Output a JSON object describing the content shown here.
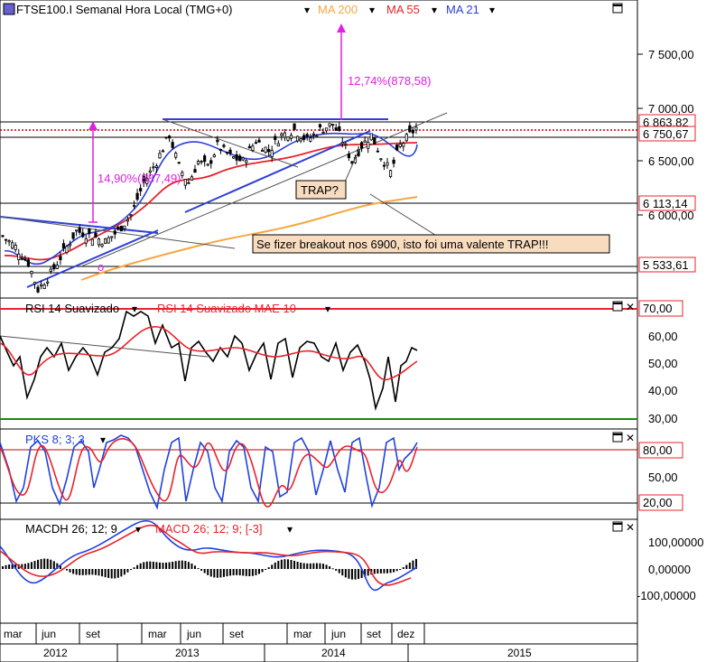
{
  "colors": {
    "ma200": "#f5a742",
    "ma55": "#e8232b",
    "ma21": "#2e3fd6",
    "magenta": "#e020e0",
    "rsi": "#000000",
    "rsi_ma": "#e8232b",
    "pks_k": "#2040e0",
    "pks_d": "#e8232b",
    "note_bg": "#f8dcc0",
    "green": "#1a8a1a"
  },
  "header": {
    "symbol": "FTSE100.I Semanal Hora Local (TMG+0)",
    "ma200": "MA 200",
    "ma55": "MA 55",
    "ma21": "MA 21"
  },
  "annotations": {
    "up_move": "12,74%(878,58)",
    "prior_move": "14,90%(887,49)",
    "trap": "TRAP?",
    "note": "Se fizer breakout nos 6900, isto foi uma valente TRAP!!!",
    "circle_marker": "o"
  },
  "price_panel": {
    "ticks": [
      "7 500,00",
      "7 000,00",
      "6 500,00",
      "6 000,00"
    ],
    "tags": [
      "6 863,82",
      "6 750,67",
      "6 113,14",
      "5 533,61"
    ]
  },
  "rsi_panel": {
    "title": "RSI 14 Suavizado",
    "title2": "RSI 14 Suavizado MAE 10",
    "ticks": [
      "60,00",
      "50,00",
      "40,00",
      "30,00"
    ],
    "tag": "70,00"
  },
  "pks_panel": {
    "title": "PKS 8; 3; 3",
    "ticks": [
      "50,00"
    ],
    "tags": [
      "80,00",
      "20,00"
    ]
  },
  "macd_panel": {
    "title": "MACDH 26; 12; 9",
    "title2": "MACD 26; 12; 9; [-3]",
    "ticks": [
      "100,00000",
      "0,00000",
      "-100,00000"
    ]
  },
  "time_axis": {
    "months": [
      "mar",
      "jun",
      "set",
      "mar",
      "jun",
      "set",
      "mar",
      "jun",
      "set",
      "dez"
    ],
    "years": [
      "2012",
      "2013",
      "2014",
      "2015"
    ]
  },
  "chart_data": {
    "type": "line",
    "title": "FTSE100.I Semanal Hora Local (TMG+0)",
    "price_key_levels": [
      6863.82,
      6750.67,
      6113.14,
      5533.61
    ],
    "price_path": [
      [
        0,
        5800
      ],
      [
        4,
        5700
      ],
      [
        8,
        5550
      ],
      [
        11,
        5300
      ],
      [
        15,
        5450
      ],
      [
        19,
        5650
      ],
      [
        23,
        5850
      ],
      [
        28,
        5800
      ],
      [
        32,
        5750
      ],
      [
        36,
        5850
      ],
      [
        40,
        6000
      ],
      [
        44,
        6300
      ],
      [
        48,
        6500
      ],
      [
        52,
        6750
      ],
      [
        55,
        6450
      ],
      [
        58,
        6300
      ],
      [
        61,
        6500
      ],
      [
        64,
        6450
      ],
      [
        67,
        6650
      ],
      [
        71,
        6550
      ],
      [
        75,
        6500
      ],
      [
        79,
        6700
      ],
      [
        83,
        6600
      ],
      [
        87,
        6750
      ],
      [
        91,
        6800
      ],
      [
        95,
        6700
      ],
      [
        99,
        6800
      ],
      [
        103,
        6850
      ],
      [
        106,
        6700
      ],
      [
        109,
        6500
      ],
      [
        112,
        6650
      ],
      [
        115,
        6750
      ],
      [
        118,
        6550
      ],
      [
        121,
        6400
      ],
      [
        124,
        6650
      ],
      [
        127,
        6750
      ],
      [
        130,
        6850
      ]
    ],
    "rsi_levels": [
      70,
      30
    ],
    "pks_levels": [
      80,
      20
    ]
  }
}
